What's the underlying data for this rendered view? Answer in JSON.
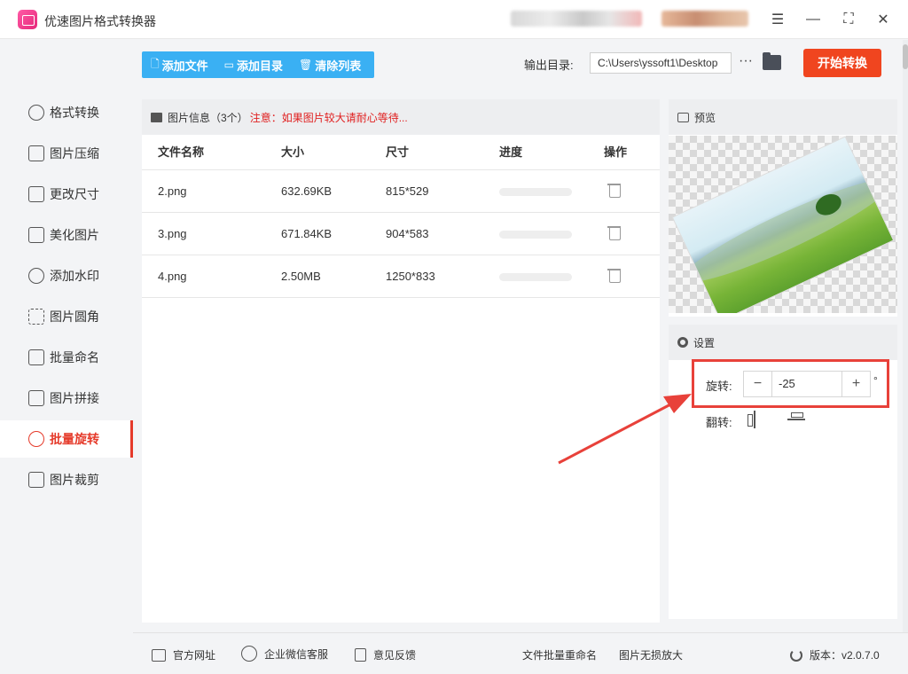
{
  "window": {
    "title": "优速图片格式转换器"
  },
  "sidebar": {
    "items": [
      {
        "label": "格式转换"
      },
      {
        "label": "图片压缩"
      },
      {
        "label": "更改尺寸"
      },
      {
        "label": "美化图片"
      },
      {
        "label": "添加水印"
      },
      {
        "label": "图片圆角"
      },
      {
        "label": "批量命名"
      },
      {
        "label": "图片拼接"
      },
      {
        "label": "批量旋转"
      },
      {
        "label": "图片裁剪"
      }
    ],
    "active_index": 8
  },
  "toolbar": {
    "add_file": "添加文件",
    "add_folder": "添加目录",
    "clear_list": "清除列表",
    "output_label": "输出目录:",
    "output_path": "C:\\Users\\yssoft1\\Desktop",
    "more": "···",
    "start": "开始转换"
  },
  "file_panel": {
    "header_title": "图片信息（3个）",
    "header_warning": "注意：如果图片较大请耐心等待...",
    "columns": [
      "文件名称",
      "大小",
      "尺寸",
      "进度",
      "操作"
    ],
    "rows": [
      {
        "name": "2.png",
        "size": "632.69KB",
        "dims": "815*529",
        "progress": 0
      },
      {
        "name": "3.png",
        "size": "671.84KB",
        "dims": "904*583",
        "progress": 0
      },
      {
        "name": "4.png",
        "size": "2.50MB",
        "dims": "1250*833",
        "progress": 0
      }
    ]
  },
  "preview": {
    "title": "预览",
    "rotation_deg": -25
  },
  "settings": {
    "title": "设置",
    "rotate_label": "旋转:",
    "rotate_value": "-25",
    "minus": "−",
    "plus": "+",
    "degree": "°",
    "flip_label": "翻转:"
  },
  "footer": {
    "website": "官方网址",
    "wechat": "企业微信客服",
    "feedback": "意见反馈",
    "batch_rename": "文件批量重命名",
    "lossless": "图片无损放大",
    "version": "版本：v2.0.7.0"
  },
  "colors": {
    "accent_blue": "#3ab0f3",
    "start_orange": "#f0451f",
    "active_red": "#e53a2a",
    "highlight_red": "#e8413a"
  }
}
